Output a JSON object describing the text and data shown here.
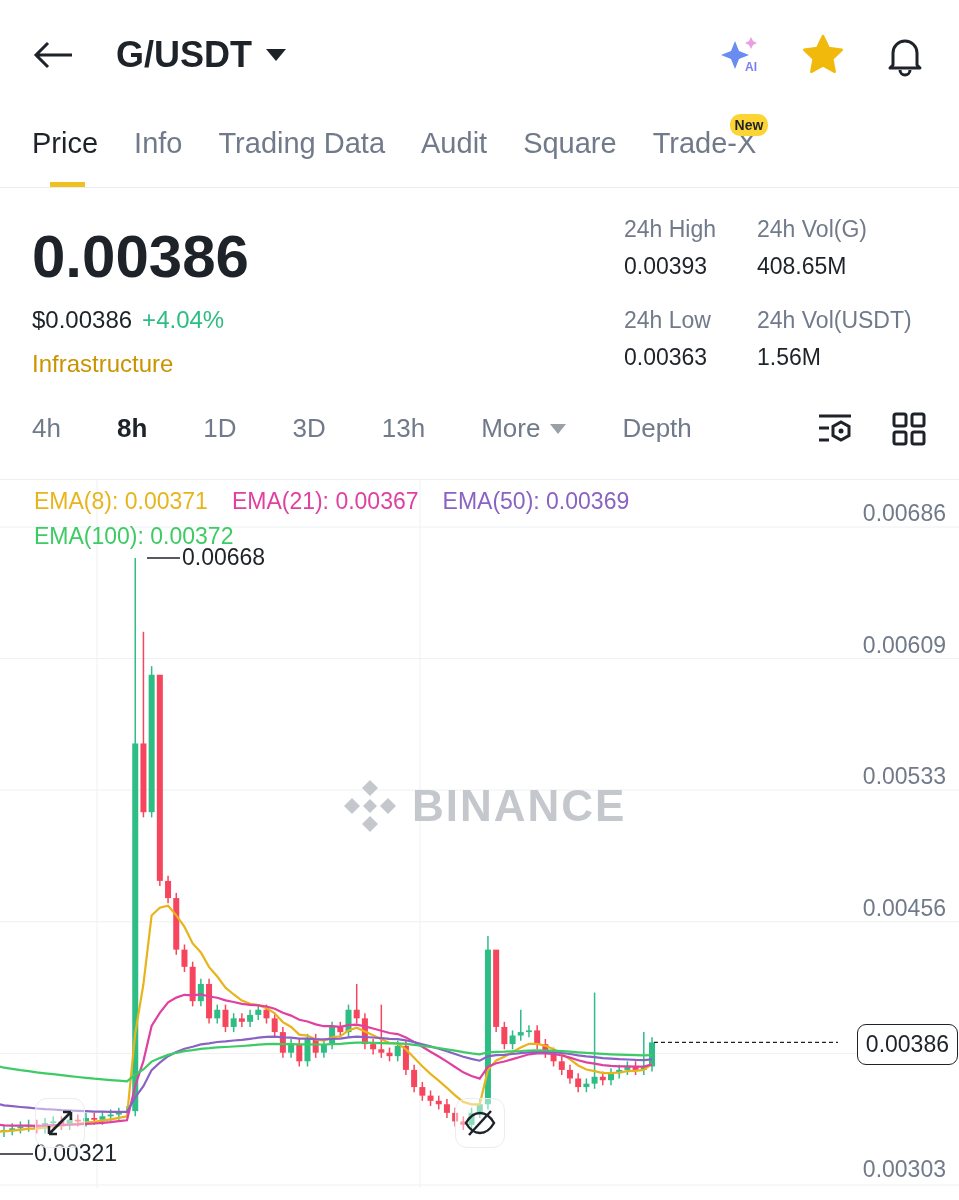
{
  "header": {
    "pair": "G/USDT",
    "ai_label": "AI",
    "favorite": true
  },
  "tabs": [
    {
      "label": "Price",
      "selected": true
    },
    {
      "label": "Info",
      "selected": false
    },
    {
      "label": "Trading Data",
      "selected": false
    },
    {
      "label": "Audit",
      "selected": false
    },
    {
      "label": "Square",
      "selected": false
    },
    {
      "label": "Trade-X",
      "selected": false,
      "badge": "New"
    }
  ],
  "price": {
    "last": "0.00386",
    "usd": "$0.00386",
    "change": "+4.04%",
    "category": "Infrastructure"
  },
  "stats": [
    {
      "label": "24h High",
      "value": "0.00393"
    },
    {
      "label": "24h Vol(G)",
      "value": "408.65M"
    },
    {
      "label": "24h Low",
      "value": "0.00363"
    },
    {
      "label": "24h Vol(USDT)",
      "value": "1.56M"
    }
  ],
  "intervals": [
    {
      "label": "4h",
      "kind": "interval",
      "selected": false
    },
    {
      "label": "8h",
      "kind": "interval",
      "selected": true
    },
    {
      "label": "1D",
      "kind": "interval",
      "selected": false
    },
    {
      "label": "3D",
      "kind": "interval",
      "selected": false
    },
    {
      "label": "13h",
      "kind": "interval",
      "selected": false
    },
    {
      "label": "More",
      "kind": "menu",
      "selected": false
    },
    {
      "label": "Depth",
      "kind": "interval",
      "selected": false
    }
  ],
  "chart": {
    "indicators": [
      {
        "label": "EMA(8): 0.00371",
        "color": "#e8b41c"
      },
      {
        "label": "EMA(21): 0.00367",
        "color": "#e040a0"
      },
      {
        "label": "EMA(50): 0.00369",
        "color": "#8a62c4"
      },
      {
        "label": "EMA(100): 0.00372",
        "color": "#3ccb64"
      }
    ],
    "price_axis": [
      "0.00686",
      "0.00609",
      "0.00533",
      "0.00456",
      "0.00303"
    ],
    "high_label": "0.00668",
    "low_label": "0.00321",
    "current_price": "0.00386",
    "watermark": "BINANCE"
  }
}
